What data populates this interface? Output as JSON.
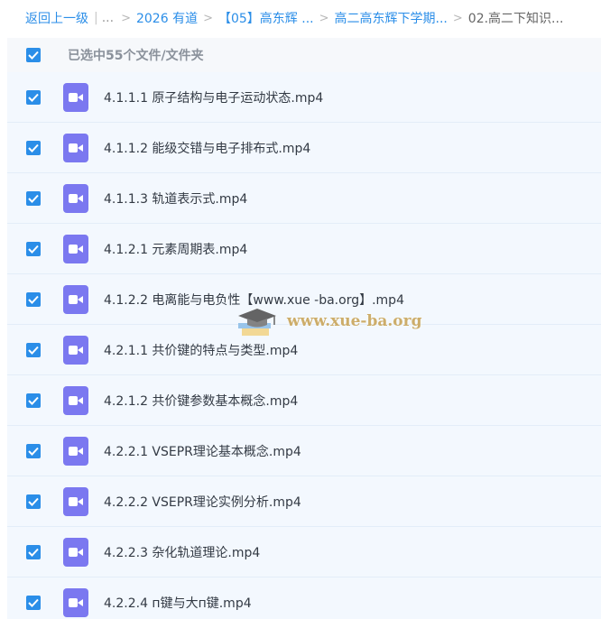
{
  "breadcrumb": {
    "back_label": "返回上一级",
    "ellipsis": "...",
    "items": [
      "2026 有道",
      "【05】高东辉 ...",
      "高二高东辉下学期...",
      "02.高二下知识..."
    ]
  },
  "selection": {
    "label": "已选中55个文件/文件夹",
    "checked": true
  },
  "files": [
    {
      "name": "4.1.1.1 原子结构与电子运动状态.mp4",
      "icon": "video-icon",
      "checked": true
    },
    {
      "name": "4.1.1.2 能级交错与电子排布式.mp4",
      "icon": "video-icon",
      "checked": true
    },
    {
      "name": "4.1.1.3 轨道表示式.mp4",
      "icon": "video-icon",
      "checked": true
    },
    {
      "name": "4.1.2.1 元素周期表.mp4",
      "icon": "video-icon",
      "checked": true
    },
    {
      "name": "4.1.2.2 电离能与电负性【www.xue -ba.org】.mp4",
      "icon": "video-icon",
      "checked": true
    },
    {
      "name": "4.2.1.1 共价键的特点与类型.mp4",
      "icon": "video-icon",
      "checked": true
    },
    {
      "name": "4.2.1.2 共价键参数基本概念.mp4",
      "icon": "video-icon",
      "checked": true
    },
    {
      "name": "4.2.2.1 VSEPR理论基本概念.mp4",
      "icon": "video-icon",
      "checked": true
    },
    {
      "name": "4.2.2.2 VSEPR理论实例分析.mp4",
      "icon": "video-icon",
      "checked": true
    },
    {
      "name": "4.2.2.3 杂化轨道理论.mp4",
      "icon": "video-icon",
      "checked": true
    },
    {
      "name": "4.2.2.4 п键与大п键.mp4",
      "icon": "video-icon",
      "checked": true
    }
  ],
  "watermark": {
    "text": "www.xue-ba.org"
  },
  "colors": {
    "accent": "#2b8ee8",
    "video_icon": "#7b78f0",
    "list_background": "#f3f8fe",
    "watermark": "#c9a55a"
  }
}
